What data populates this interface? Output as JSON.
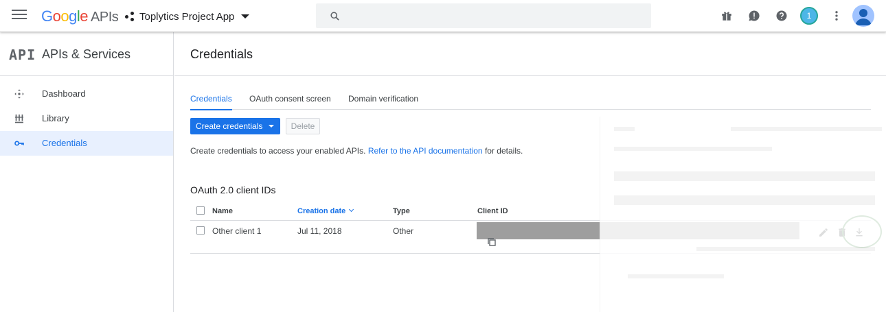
{
  "topbar": {
    "logo_google": "Google",
    "logo_apis": "APIs",
    "project_name": "Toplytics Project App",
    "search_placeholder": "",
    "notification_count": "1"
  },
  "sidebar": {
    "glyph": "API",
    "title": "APIs & Services",
    "items": [
      {
        "label": "Dashboard",
        "icon": "dashboard-icon"
      },
      {
        "label": "Library",
        "icon": "library-icon"
      },
      {
        "label": "Credentials",
        "icon": "key-icon",
        "active": true
      }
    ]
  },
  "main": {
    "title": "Credentials",
    "tabs": [
      "Credentials",
      "OAuth consent screen",
      "Domain verification"
    ],
    "create_button": "Create credentials",
    "delete_button": "Delete",
    "info_prefix": "Create credentials to access your enabled APIs.",
    "info_link": "Refer to the API documentation",
    "info_suffix": "for details.",
    "section_title": "OAuth 2.0 client IDs",
    "columns": [
      "Name",
      "Creation date",
      "Type",
      "Client ID"
    ],
    "rows": [
      {
        "name": "Other client 1",
        "date": "Jul 11, 2018",
        "type": "Other",
        "client_id": ""
      }
    ]
  },
  "colors": {
    "accent": "#1a73e8",
    "active_bg": "#e8f0fe",
    "highlight_ring": "#2e7d32",
    "redaction": "#9e9e9e"
  }
}
